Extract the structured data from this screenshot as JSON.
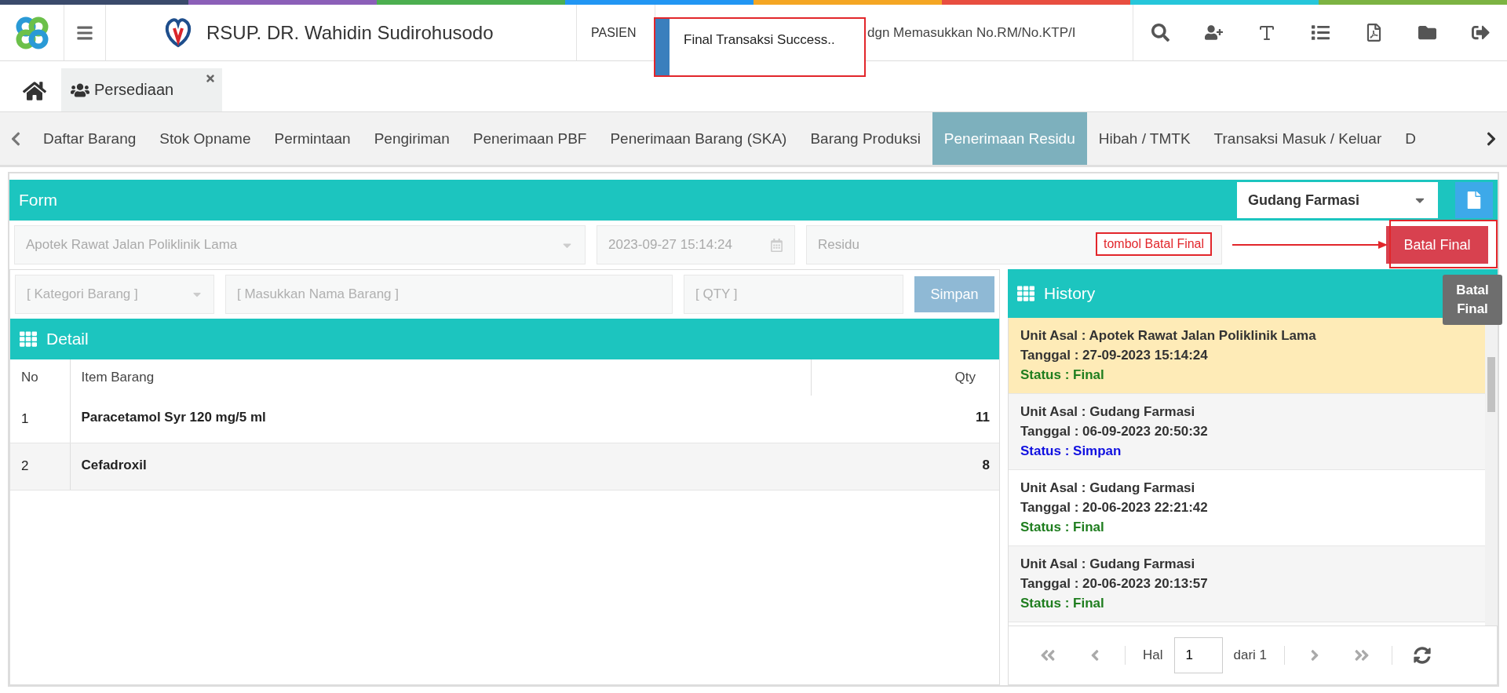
{
  "app": {
    "title": "RSUP. DR. Wahidin Sudirohusodo",
    "patient_label": "PASIEN",
    "search": {
      "placeholder": "dgn Memasukkan No.RM/No.KTP/I"
    }
  },
  "toast": {
    "message": "Final Transaksi Success.."
  },
  "open_tabs": [
    {
      "label": "Persediaan",
      "selected": true
    }
  ],
  "nav_tabs": [
    {
      "label": "Daftar Barang",
      "selected": false
    },
    {
      "label": "Stok Opname",
      "selected": false
    },
    {
      "label": "Permintaan",
      "selected": false
    },
    {
      "label": "Pengiriman",
      "selected": false
    },
    {
      "label": "Penerimaan PBF",
      "selected": false
    },
    {
      "label": "Penerimaan Barang (SKA)",
      "selected": false
    },
    {
      "label": "Barang Produksi",
      "selected": false
    },
    {
      "label": "Penerimaan Residu",
      "selected": true
    },
    {
      "label": "Hibah / TMTK",
      "selected": false
    },
    {
      "label": "Transaksi Masuk / Keluar",
      "selected": false
    },
    {
      "label": "D",
      "selected": false
    }
  ],
  "form": {
    "title": "Form",
    "warehouse": "Gudang Farmasi",
    "unit": "Apotek Rawat Jalan Poliklinik Lama",
    "date": "2023-09-27 15:14:24",
    "type": "Residu",
    "fields_disabled": true,
    "cancel_button": "Batal Final",
    "tooltip": "Batal Final"
  },
  "annotation": {
    "label": "tombol Batal Final"
  },
  "item_entry": {
    "category_placeholder": "[ Kategori Barang ]",
    "name_placeholder": "[ Masukkan Nama Barang ]",
    "qty_placeholder": "[ QTY ]",
    "save_button": "Simpan",
    "disabled": true
  },
  "detail": {
    "title": "Detail",
    "columns": [
      "No",
      "Item Barang",
      "Qty"
    ],
    "rows": [
      {
        "no": "1",
        "item": "Paracetamol Syr 120 mg/5 ml",
        "qty": "11"
      },
      {
        "no": "2",
        "item": "Cefadroxil",
        "qty": "8"
      }
    ]
  },
  "history": {
    "title": "History",
    "items": [
      {
        "unit": "Unit Asal : Apotek Rawat Jalan Poliklinik Lama",
        "date": "Tanggal : 27-09-2023 15:14:24",
        "status": "Status : Final",
        "color": "#1e7d1e",
        "selected": true
      },
      {
        "unit": "Unit Asal : Gudang Farmasi",
        "date": "Tanggal : 06-09-2023 20:50:32",
        "status": "Status : Simpan",
        "color": "#1010e0",
        "selected": false
      },
      {
        "unit": "Unit Asal : Gudang Farmasi",
        "date": "Tanggal : 20-06-2023 22:21:42",
        "status": "Status : Final",
        "color": "#1e7d1e",
        "selected": false
      },
      {
        "unit": "Unit Asal : Gudang Farmasi",
        "date": "Tanggal : 20-06-2023 20:13:57",
        "status": "Status : Final",
        "color": "#1e7d1e",
        "selected": false
      }
    ],
    "pager": {
      "page_label": "Hal",
      "page": "1",
      "total": "dari 1"
    }
  }
}
